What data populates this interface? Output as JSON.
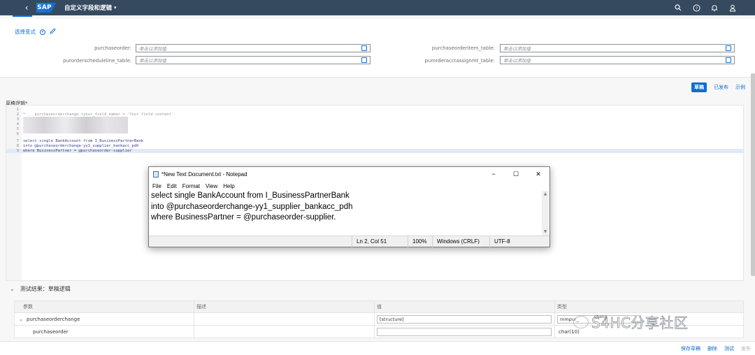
{
  "shell": {
    "back_icon": "chevron-left-icon",
    "logo": "SAP",
    "app_title": "自定义字段和逻辑",
    "icons": [
      "search-icon",
      "help-icon",
      "notification-icon",
      "user-icon"
    ]
  },
  "filterbar": {
    "variant_label": "选择变式",
    "fields": [
      {
        "label": "purchaseorder:",
        "placeholder": "单击以添加值"
      },
      {
        "label": "purorderscheduleline_table:",
        "placeholder": "单击以添加值"
      },
      {
        "label": "purchaseorderitem_table:",
        "placeholder": "单击以添加值"
      },
      {
        "label": "purorderacctassignmt_table:",
        "placeholder": "单击以添加值"
      }
    ]
  },
  "editor_tabs": {
    "draft": "草稿",
    "published": "已发布",
    "example": "示例"
  },
  "editor": {
    "label": "草稿逻辑",
    "required": "*",
    "lines": [
      {
        "num": "1",
        "text": ""
      },
      {
        "num": "2",
        "text": "*    purchaseorderchange-<your_field_name> = 'Your field content'."
      },
      {
        "num": "3",
        "text": ""
      },
      {
        "num": "4",
        "text": ""
      },
      {
        "num": "5",
        "text": ""
      },
      {
        "num": "6",
        "text": ""
      },
      {
        "num": "7",
        "text": "select single BankAccount from I_BusinessPartnerBank"
      },
      {
        "num": "8",
        "text": "into @purchaseorderchange-yy1_supplier_bankacc_pdh"
      },
      {
        "num": "9",
        "text": "where BusinessPartner = @purchaseorder-supplier"
      }
    ]
  },
  "notepad": {
    "title": "*New Text Document.txt - Notepad",
    "controls": [
      "−",
      "☐",
      "✕"
    ],
    "menu": [
      "File",
      "Edit",
      "Format",
      "View",
      "Help"
    ],
    "text_lines": [
      "select single BankAccount from I_BusinessPartnerBank",
      "into @purchaseorderchange-yy1_supplier_bankacc_pdh",
      "where BusinessPartner = @purchaseorder-supplier."
    ],
    "status": {
      "position": "Ln 2, Col 51",
      "zoom": "100%",
      "line_ending": "Windows (CRLF)",
      "encoding": "UTF-8"
    }
  },
  "test": {
    "header": "测试结果：草稿逻辑",
    "columns": [
      "参数",
      "描述",
      "值",
      "类型"
    ],
    "rows": [
      {
        "param": "purchaseorderchange",
        "desc": "",
        "value": "[structure]",
        "type": "mmpur_"
      },
      {
        "param": "purchaseorder",
        "desc": "",
        "value": "",
        "type": "char(10)"
      }
    ]
  },
  "watermark": {
    "text": "S4HC分享社区",
    "small": "chang"
  },
  "footer": {
    "save_draft": "保存草稿",
    "delete": "删除",
    "test": "测试",
    "publish": "发布"
  }
}
